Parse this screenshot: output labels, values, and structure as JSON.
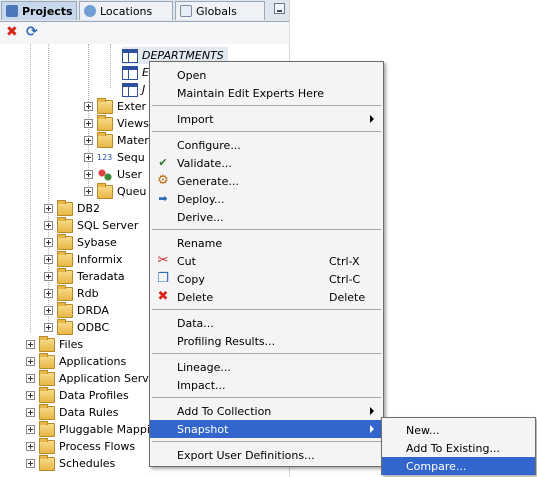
{
  "tabs": [
    {
      "label": "Projects",
      "icon": "projects-icon",
      "active": true
    },
    {
      "label": "Locations",
      "icon": "locations-icon",
      "active": false
    },
    {
      "label": "Globals",
      "icon": "globals-icon",
      "active": false
    }
  ],
  "toolbar": {
    "delete_icon": "delete-icon",
    "refresh_icon": "refresh-icon"
  },
  "tree": {
    "departments": "DEPARTMENTS",
    "e_item": "E",
    "j_item": "J",
    "external": "Exter",
    "views": "Views",
    "materialized": "Mater",
    "sequences": "Sequ",
    "user": "User",
    "queues": "Queu",
    "db2": "DB2",
    "sql_server": "SQL Server",
    "sybase": "Sybase",
    "informix": "Informix",
    "teradata": "Teradata",
    "rdb": "Rdb",
    "drda": "DRDA",
    "odbc": "ODBC",
    "files": "Files",
    "applications": "Applications",
    "application_serv": "Application Serv",
    "data_profiles": "Data Profiles",
    "data_rules": "Data Rules",
    "pluggable": "Pluggable Mappi",
    "process_flows": "Process Flows",
    "schedules": "Schedules"
  },
  "context_menu": {
    "open": "Open",
    "maintain": "Maintain Edit Experts Here",
    "import": "Import",
    "configure": "Configure...",
    "validate": "Validate...",
    "generate": "Generate...",
    "deploy": "Deploy...",
    "derive": "Derive...",
    "rename": "Rename",
    "cut": "Cut",
    "cut_shortcut": "Ctrl-X",
    "copy": "Copy",
    "copy_shortcut": "Ctrl-C",
    "delete": "Delete",
    "delete_shortcut": "Delete",
    "data": "Data...",
    "profiling": "Profiling Results...",
    "lineage": "Lineage...",
    "impact": "Impact...",
    "add_to_collection": "Add To Collection",
    "snapshot": "Snapshot",
    "export": "Export User Definitions..."
  },
  "submenu": {
    "new": "New...",
    "add_to_existing": "Add To Existing...",
    "compare": "Compare..."
  },
  "colors": {
    "highlight": "#3366cc",
    "menu_bg": "#f4f4f4",
    "tab_active": "#c7d8ec"
  }
}
